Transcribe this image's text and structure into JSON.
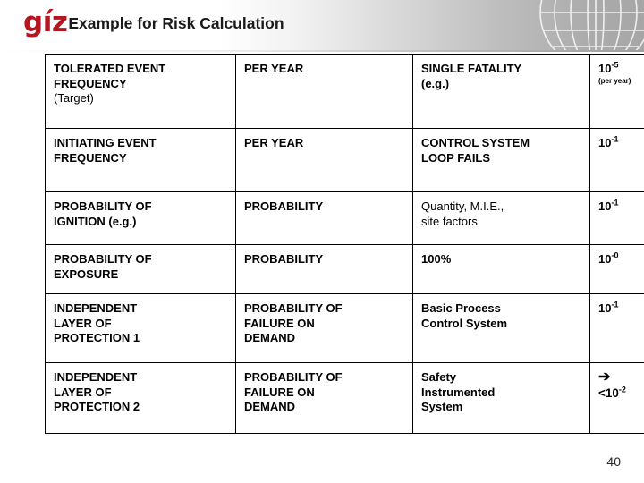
{
  "header": {
    "logo_text": "gíz",
    "logo_color": "#b4171f",
    "title": "Example for Risk Calculation",
    "globe_icon": "globe-wireframe-icon"
  },
  "accent_color": "#e0431a",
  "table": {
    "rows": [
      {
        "col1": {
          "line1": "TOLERATED EVENT",
          "line2": "FREQUENCY",
          "line3": "(Target)"
        },
        "col2": {
          "line1": "PER YEAR"
        },
        "col3": {
          "line1": "SINGLE FATALITY",
          "line2": "(e.g.)"
        },
        "col4": {
          "base": "10",
          "exponent": "-5",
          "note": "(per year)"
        }
      },
      {
        "col1": {
          "line1": "INITIATING EVENT",
          "line2": "FREQUENCY"
        },
        "col2": {
          "line1": "PER YEAR"
        },
        "col3": {
          "line1": "CONTROL SYSTEM",
          "line2": "LOOP FAILS"
        },
        "col4": {
          "base": "10",
          "exponent": "-1"
        }
      },
      {
        "col1": {
          "line1": "PROBABILITY OF",
          "line2": "IGNITION (e.g.)"
        },
        "col2": {
          "line1": "PROBABILITY"
        },
        "col3": {
          "line1": "Quantity, M.I.E.,",
          "line2": "site factors"
        },
        "col4": {
          "base": "10",
          "exponent": "-1"
        }
      },
      {
        "col1": {
          "line1": "PROBABILITY OF",
          "line2": "EXPOSURE"
        },
        "col2": {
          "line1": "PROBABILITY"
        },
        "col3": {
          "line1": "100%"
        },
        "col4": {
          "base": "10",
          "exponent": "-0"
        }
      },
      {
        "col1": {
          "line1": "INDEPENDENT",
          "line2": "LAYER OF",
          "line3": "PROTECTION 1"
        },
        "col2": {
          "line1": "PROBABILITY OF",
          "line2": "FAILURE ON",
          "line3": "DEMAND"
        },
        "col3": {
          "line1": "Basic Process",
          "line2": "Control System"
        },
        "col4": {
          "base": "10",
          "exponent": "-1"
        }
      },
      {
        "col1": {
          "line1": "INDEPENDENT",
          "line2": "LAYER OF",
          "line3": "PROTECTION 2"
        },
        "col2": {
          "line1": "PROBABILITY OF",
          "line2": "FAILURE ON",
          "line3": "DEMAND"
        },
        "col3": {
          "line1": "Safety",
          "line2": "Instrumented",
          "line3": "System"
        },
        "col4": {
          "arrow": "➔",
          "prefix": "<10",
          "exponent": "-2"
        }
      }
    ]
  },
  "footer": {
    "page_number": "40"
  }
}
